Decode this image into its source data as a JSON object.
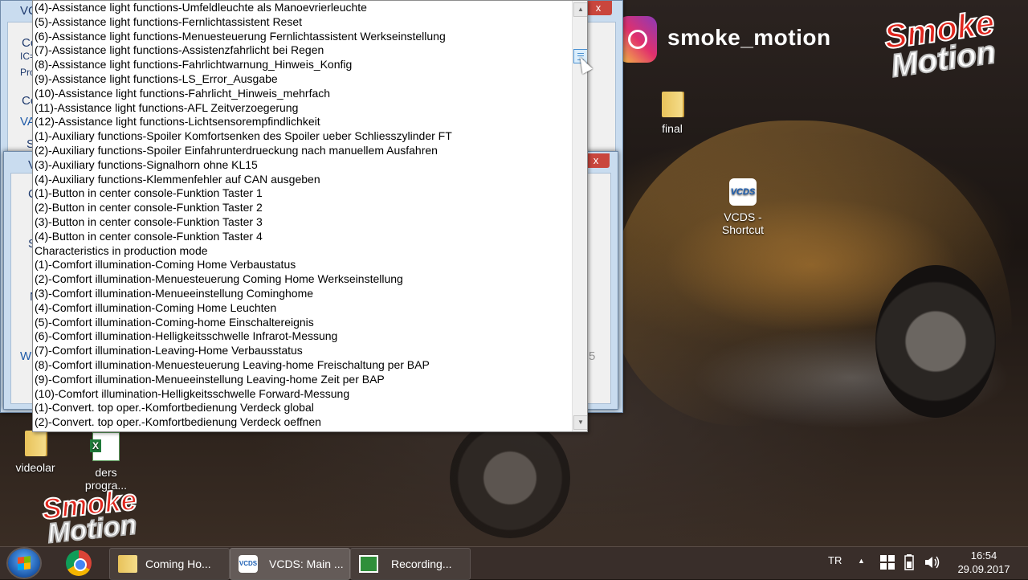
{
  "listbox": {
    "items": [
      "(4)-Assistance light functions-Umfeldleuchte als Manoevrierleuchte",
      "(5)-Assistance light functions-Fernlichtassistent Reset",
      "(6)-Assistance light functions-Menuesteuerung Fernlichtassistent Werkseinstellung",
      "(7)-Assistance light functions-Assistenzfahrlicht bei Regen",
      "(8)-Assistance light functions-Fahrlichtwarnung_Hinweis_Konfig",
      "(9)-Assistance light functions-LS_Error_Ausgabe",
      "(10)-Assistance light functions-Fahrlicht_Hinweis_mehrfach",
      "(11)-Assistance light functions-AFL Zeitverzoegerung",
      "(12)-Assistance light functions-Lichtsensorempfindlichkeit",
      "(1)-Auxiliary functions-Spoiler Komfortsenken des Spoiler ueber Schliesszylinder FT",
      "(2)-Auxiliary functions-Spoiler Einfahrunterdrueckung nach manuellem Ausfahren",
      "(3)-Auxiliary functions-Signalhorn ohne KL15",
      "(4)-Auxiliary functions-Klemmenfehler auf CAN ausgeben",
      "(1)-Button in center console-Funktion Taster 1",
      "(2)-Button in center console-Funktion Taster 2",
      "(3)-Button in center console-Funktion Taster 3",
      "(4)-Button in center console-Funktion Taster 4",
      "Characteristics in production mode",
      "(1)-Comfort illumination-Coming Home Verbaustatus",
      "(2)-Comfort illumination-Menuesteuerung Coming Home Werkseinstellung",
      "(3)-Comfort illumination-Menueeinstellung Cominghome",
      "(4)-Comfort illumination-Coming Home Leuchten",
      "(5)-Comfort illumination-Coming-home Einschaltereignis",
      "(6)-Comfort illumination-Helligkeitsschwelle Infrarot-Messung",
      "(7)-Comfort illumination-Leaving-Home Verbausstatus",
      "(8)-Comfort illumination-Menuesteuerung Leaving-home Freischaltung per BAP",
      "(9)-Comfort illumination-Menueeinstellung Leaving-home Zeit per BAP",
      "(10)-Comfort illumination-Helligkeitsschwelle Forward-Messung",
      "(1)-Convert. top oper.-Komfortbedienung Verdeck global",
      "(2)-Convert. top oper.-Komfortbedienung Verdeck oeffnen"
    ]
  },
  "back_window": {
    "close": "x",
    "fragments": [
      "VC",
      "Co",
      "IC=",
      "Pro",
      "Co",
      "VA",
      "S"
    ]
  },
  "mid_window": {
    "close": "x",
    "fragments": [
      "V",
      "C",
      "S",
      "N",
      "W",
      "5"
    ]
  },
  "overlay": {
    "instagram_handle": "smoke_motion",
    "logo_line1": "Smoke",
    "logo_line2": "Motion"
  },
  "desktop_icons": {
    "final": "final",
    "vcds_line1": "VCDS -",
    "vcds_line2": "Shortcut",
    "vcds_glyph": "VCDS",
    "videolar": "videolar",
    "ders_line1": "ders",
    "ders_line2": "progra..."
  },
  "taskbar": {
    "buttons": [
      {
        "label": "Coming Ho..."
      },
      {
        "label": "VCDS:  Main ..."
      },
      {
        "label": "Recording..."
      }
    ],
    "vcds_glyph": "VCDS",
    "language": "TR",
    "tray_up": "▲",
    "time": "16:54",
    "date": "29.09.2017"
  }
}
